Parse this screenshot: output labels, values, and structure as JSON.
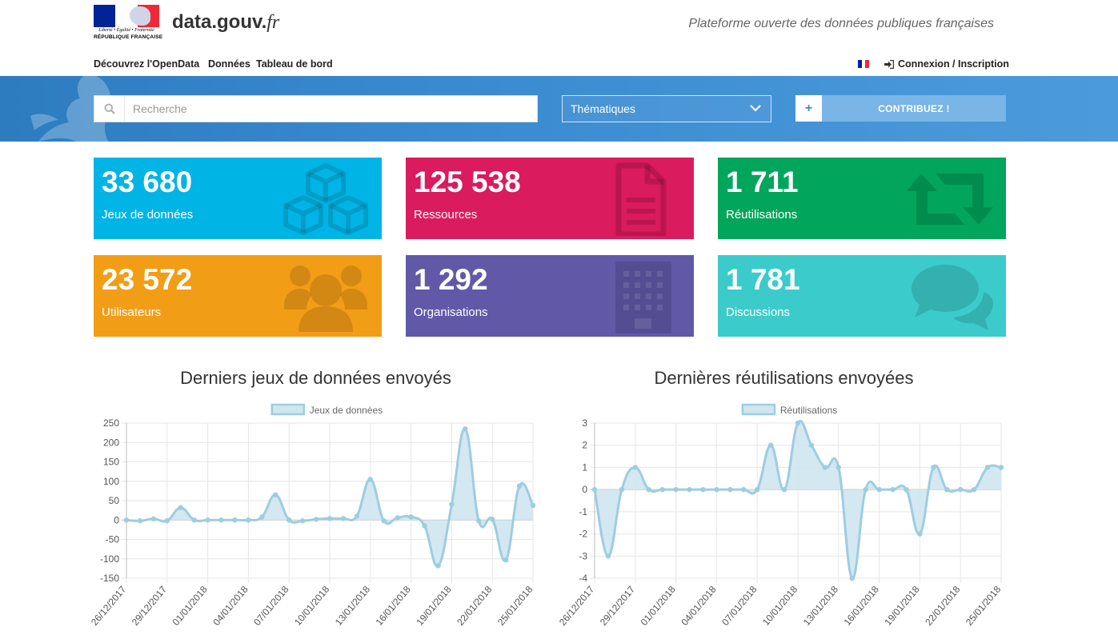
{
  "header": {
    "logo": {
      "motto": "Liberté • Égalité • Fraternité",
      "republic": "RÉPUBLIQUE FRANÇAISE"
    },
    "brand_name": "data.gouv.",
    "brand_tld": "fr",
    "tagline": "Plateforme ouverte des données publiques françaises",
    "nav": [
      "Découvrez l'OpenData",
      "Données",
      "Tableau de bord"
    ],
    "login_label": "Connexion / Inscription",
    "login_icon": "sign-in-icon",
    "language_icon": "french-flag-icon"
  },
  "search": {
    "placeholder": "Recherche",
    "icon": "search-icon",
    "thematiques_label": "Thématiques",
    "contribute_label": "CONTRIBUEZ !"
  },
  "stats": [
    {
      "value": "33 680",
      "label": "Jeux de données",
      "color": "#00b5e6",
      "icon": "cubes-icon"
    },
    {
      "value": "125 538",
      "label": "Ressources",
      "color": "#da1b5d",
      "icon": "file-icon"
    },
    {
      "value": "1 711",
      "label": "Réutilisations",
      "color": "#01a55b",
      "icon": "retweet-icon"
    },
    {
      "value": "23 572",
      "label": "Utilisateurs",
      "color": "#f29d16",
      "icon": "users-icon"
    },
    {
      "value": "1 292",
      "label": "Organisations",
      "color": "#6159a8",
      "icon": "building-icon"
    },
    {
      "value": "1 781",
      "label": "Discussions",
      "color": "#3ccbcb",
      "icon": "comments-icon"
    }
  ],
  "charts": {
    "fill_color": "#cfe6ef",
    "line_color": "#9dcde0"
  },
  "chart_data": [
    {
      "type": "area",
      "title": "Derniers jeux de données envoyés",
      "x_tick_labels": [
        "26/12/2017",
        "29/12/2017",
        "01/01/2018",
        "04/01/2018",
        "07/01/2018",
        "10/01/2018",
        "13/01/2018",
        "16/01/2018",
        "19/01/2018",
        "22/01/2018",
        "25/01/2018"
      ],
      "y_ticks": [
        250,
        200,
        150,
        100,
        50,
        0,
        -50,
        -100,
        -150
      ],
      "ylim": [
        -150,
        250
      ],
      "grid": true,
      "legend_position": "top-center",
      "series": [
        {
          "name": "Jeux de données",
          "values": [
            0,
            -2,
            3,
            -2,
            32,
            0,
            0,
            0,
            0,
            0,
            8,
            65,
            0,
            -2,
            2,
            4,
            4,
            10,
            105,
            -2,
            6,
            8,
            -15,
            -118,
            40,
            235,
            -2,
            2,
            -103,
            88,
            38
          ]
        }
      ]
    },
    {
      "type": "area",
      "title": "Dernières réutilisations envoyées",
      "x_tick_labels": [
        "26/12/2017",
        "29/12/2017",
        "01/01/2018",
        "04/01/2018",
        "07/01/2018",
        "10/01/2018",
        "13/01/2018",
        "16/01/2018",
        "19/01/2018",
        "22/01/2018",
        "25/01/2018"
      ],
      "y_ticks": [
        3,
        2,
        1,
        0,
        -1,
        -2,
        -3,
        -4
      ],
      "ylim": [
        -4,
        3
      ],
      "grid": true,
      "legend_position": "top-center",
      "series": [
        {
          "name": "Réutilisations",
          "values": [
            0,
            -3,
            0,
            1,
            0,
            0,
            0,
            0,
            0,
            0,
            0,
            0,
            0,
            2,
            0,
            3,
            2,
            1,
            1,
            -4,
            0,
            0,
            0,
            0,
            -2,
            1,
            0,
            0,
            0,
            1,
            1
          ]
        }
      ]
    }
  ]
}
